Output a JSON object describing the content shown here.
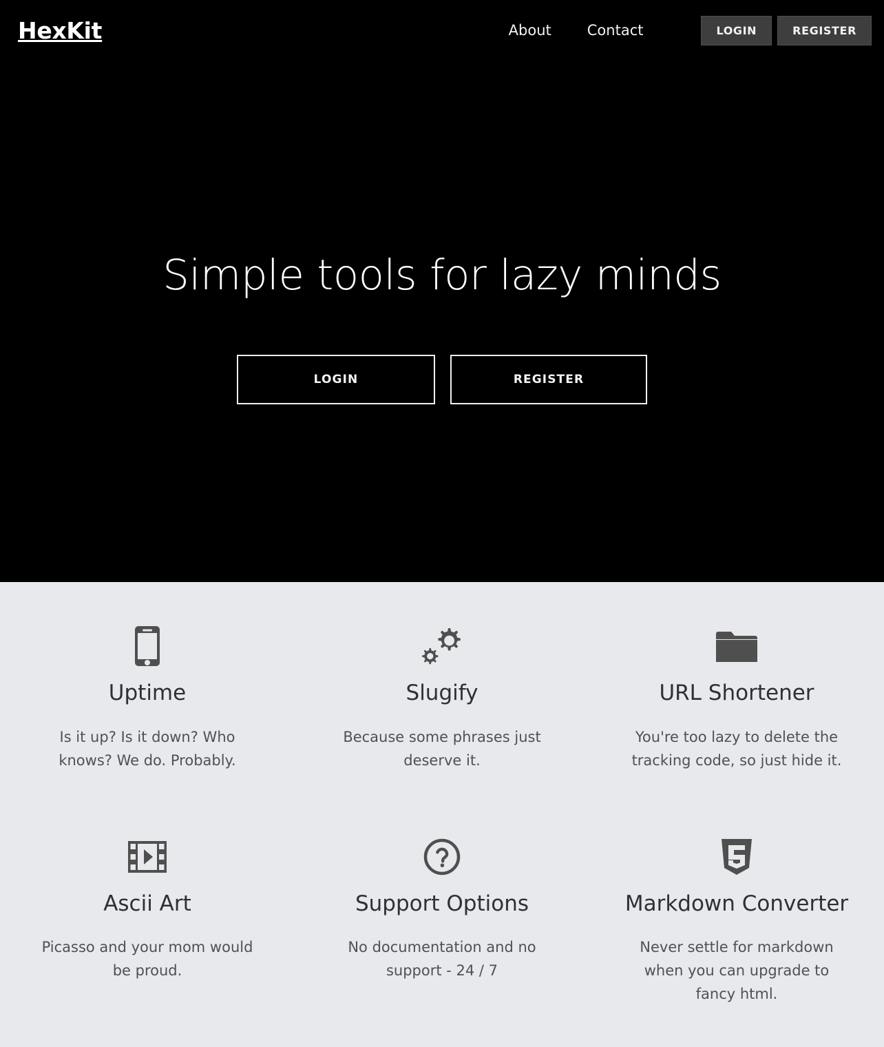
{
  "brand": {
    "name": "HexKit"
  },
  "nav": {
    "links": [
      {
        "label": "About",
        "name": "nav-link-about"
      },
      {
        "label": "Contact",
        "name": "nav-link-contact"
      }
    ],
    "buttons": [
      {
        "label": "LOGIN",
        "name": "nav-login-button"
      },
      {
        "label": "REGISTER",
        "name": "nav-register-button"
      }
    ]
  },
  "hero": {
    "title": "Simple tools for lazy minds",
    "login_label": "LOGIN",
    "register_label": "REGISTER",
    "background_color": "#000000",
    "text_color": "#ffffff"
  },
  "features": {
    "background_color": "#e7e9ec",
    "icon_color": "#4f4f4f",
    "items": [
      {
        "icon": "mobile-phone-icon",
        "title": "Uptime",
        "desc": "Is it up? Is it down? Who knows? We do. Probably."
      },
      {
        "icon": "cogs-icon",
        "title": "Slugify",
        "desc": "Because some phrases just deserve it."
      },
      {
        "icon": "folder-icon",
        "title": "URL Shortener",
        "desc": "You're too lazy to delete the tracking code, so just hide it."
      },
      {
        "icon": "film-play-icon",
        "title": "Ascii Art",
        "desc": "Picasso and your mom would be proud."
      },
      {
        "icon": "question-circle-icon",
        "title": "Support Options",
        "desc": "No documentation and no support - 24 / 7"
      },
      {
        "icon": "html5-shield-icon",
        "title": "Markdown Converter",
        "desc": "Never settle for markdown when you can upgrade to fancy html."
      }
    ]
  }
}
